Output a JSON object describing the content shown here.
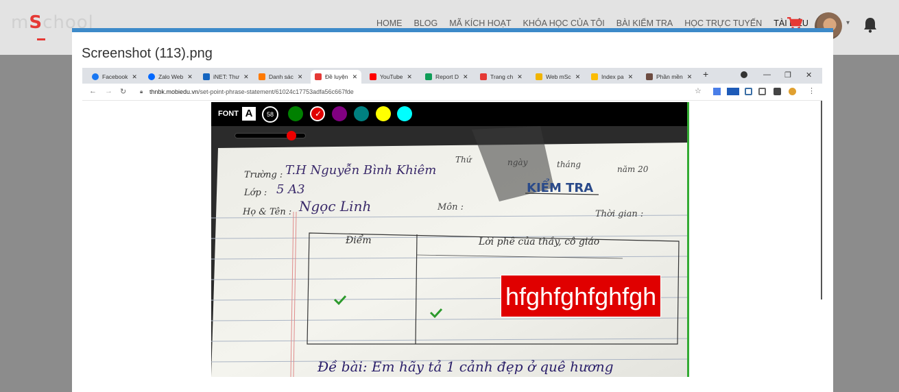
{
  "site": {
    "logo_prefix": "m",
    "logo_s": "S",
    "logo_suffix": "chool",
    "nav": [
      "HOME",
      "BLOG",
      "MÃ KÍCH HOẠT",
      "KHÓA HỌC CỦA TÔI",
      "BÀI KIỂM TRA",
      "HỌC TRỰC TUYẾN",
      "TÀI LIỆU"
    ],
    "active_nav": "TÀI LIỆU"
  },
  "modal": {
    "title": "Screenshot (113).png"
  },
  "browser": {
    "tabs": [
      {
        "label": "Facebook",
        "icon": "facebook-icon",
        "color": "#1877f2"
      },
      {
        "label": "Zalo Web",
        "icon": "zalo-icon",
        "color": "#0068ff"
      },
      {
        "label": "iNET: Thư",
        "icon": "inet-icon",
        "color": "#1565c0"
      },
      {
        "label": "Danh sác",
        "icon": "list-icon",
        "color": "#ff7a00"
      },
      {
        "label": "Đề luyện",
        "icon": "doc-icon",
        "color": "#e53935",
        "active": true
      },
      {
        "label": "YouTube",
        "icon": "youtube-icon",
        "color": "#ff0000"
      },
      {
        "label": "Report D",
        "icon": "sheets-icon",
        "color": "#0f9d58"
      },
      {
        "label": "Trang ch",
        "icon": "doc-icon",
        "color": "#e53935"
      },
      {
        "label": "Web mSc",
        "icon": "web-icon",
        "color": "#f0b400"
      },
      {
        "label": "Index pa",
        "icon": "drive-icon",
        "color": "#fbbc04"
      },
      {
        "label": "Phần mền",
        "icon": "app-icon",
        "color": "#6d4c41"
      }
    ],
    "url_host": "thnbk.mobiedu.vn",
    "url_path": "/set-point-phrase-statement/61024c17753adfa56c667fde"
  },
  "editor": {
    "font_label": "FONT",
    "font_a": "A",
    "font_size": "58",
    "swatches": [
      {
        "name": "green",
        "color": "#008000"
      },
      {
        "name": "red",
        "color": "#e00000",
        "selected": true
      },
      {
        "name": "purple",
        "color": "#800080"
      },
      {
        "name": "teal",
        "color": "#008080"
      },
      {
        "name": "yellow",
        "color": "#ffff00"
      },
      {
        "name": "cyan",
        "color": "#00ffff"
      }
    ],
    "check": "✓",
    "overlay_text": "hfghfghfghfgh"
  },
  "paper": {
    "school_label": "Trường :",
    "school_value": "T.H Nguyễn Bình Khiêm",
    "class_label": "Lớp :",
    "class_value": "5 A3",
    "name_label": "Họ & Tên :",
    "name_value": "Ngọc Linh",
    "date_thu": "Thứ",
    "date_ngay": "ngày",
    "date_thang": "tháng",
    "date_nam": "năm 20",
    "heading": "KIỂM TRA",
    "subject_label": "Môn :",
    "time_label": "Thời gian :",
    "score_header": "Điểm",
    "comment_header": "Lời phê của thầy, cô giáo",
    "prompt": "Đề bài: Em hãy tả 1 cảnh đẹp ở quê hương"
  }
}
